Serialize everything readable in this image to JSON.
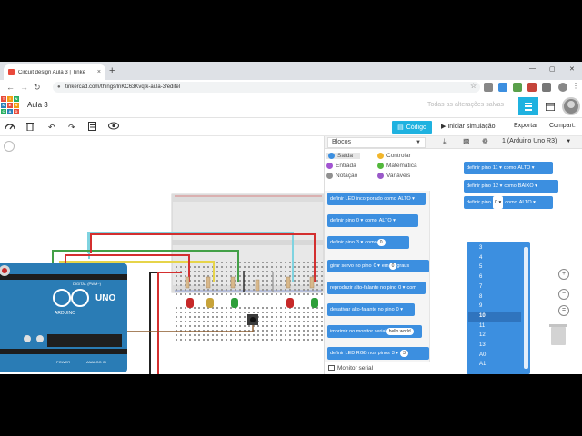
{
  "browser": {
    "tab_title": "Circuit design Aula 3 | Tinke",
    "tab_close": "×",
    "new_tab": "+",
    "url": "tinkercad.com/things/lnKC63Kvqtk-aula-3/editel",
    "nav_back": "←",
    "nav_forward": "→",
    "reload": "↻",
    "lock": "🔒",
    "star": "☆",
    "menu": "⋮",
    "win_min": "—",
    "win_max": "▢",
    "win_close": "✕"
  },
  "header": {
    "logo_letters": [
      "TIN",
      "KER",
      "CAD"
    ],
    "project_title": "Aula 3",
    "saved_status": "Todas as alterações salvas"
  },
  "toolbar": {
    "code_label": "Código",
    "simulate_label": "Iniciar simulação",
    "export_label": "Exportar",
    "share_label": "Compart."
  },
  "code_panel": {
    "mode_select": "Blocos",
    "device_select": "1 (Arduino Uno R3)",
    "categories": [
      {
        "label": "Saída",
        "color": "#3c8fe0",
        "selected": true
      },
      {
        "label": "Controlar",
        "color": "#f2b62b",
        "selected": false
      },
      {
        "label": "Entrada",
        "color": "#a255d1",
        "selected": false
      },
      {
        "label": "Matemática",
        "color": "#53b83c",
        "selected": false
      },
      {
        "label": "Notação",
        "color": "#909090",
        "selected": false
      },
      {
        "label": "Variáveis",
        "color": "#9a59c9",
        "selected": false
      }
    ],
    "palette_blocks": [
      {
        "label": "definir LED incorporado como",
        "value": "ALTO"
      },
      {
        "label": "definir pino",
        "pin": "0",
        "mid": "como",
        "value": "ALTO"
      },
      {
        "label": "definir pino",
        "pin": "3",
        "mid": "como",
        "value": "0"
      },
      {
        "label": "girar servo no pino",
        "pin": "0",
        "mid": "em",
        "value": "0",
        "suffix": "graus"
      },
      {
        "label": "reproduzir alto-falante no pino",
        "pin": "0",
        "mid": "com"
      },
      {
        "label": "desativar alto-falante no pino",
        "pin": "0"
      },
      {
        "label": "imprimir no monitor serial",
        "value": "hello world"
      },
      {
        "label": "definir LED RGB nos pinos",
        "pin": "3",
        "value": "3"
      }
    ],
    "workspace_blocks": [
      {
        "label": "definir pino",
        "pin": "11",
        "mid": "como",
        "value": "ALTO"
      },
      {
        "label": "definir pino",
        "pin": "12",
        "mid": "como",
        "value": "BAIXO"
      },
      {
        "label": "definir pino",
        "pin": "0",
        "mid": "como",
        "value": "ALTO"
      }
    ],
    "dropdown_options": [
      "3",
      "4",
      "5",
      "6",
      "7",
      "8",
      "9",
      "10",
      "11",
      "12",
      "13",
      "A0",
      "A1"
    ],
    "dropdown_selected": "10",
    "serial_monitor_label": "Monitor serial"
  },
  "circuit": {
    "board_name": "UNO",
    "board_brand": "ARDUINO",
    "digital_label": "DIGITAL (PWM~)",
    "analog_label": "ANALOG IN",
    "power_label": "POWER",
    "led_colors": [
      "#c62828",
      "#c7a33a",
      "#2e9e3a",
      "#c62828",
      "#2e9e3a"
    ],
    "wire_colors": {
      "red": "#d32f2f",
      "green": "#43a047",
      "yellow": "#e6d44a",
      "cyan": "#7fd3e0",
      "black": "#222222",
      "gray": "#9e9e9e",
      "brown": "#8b5a2b"
    }
  }
}
